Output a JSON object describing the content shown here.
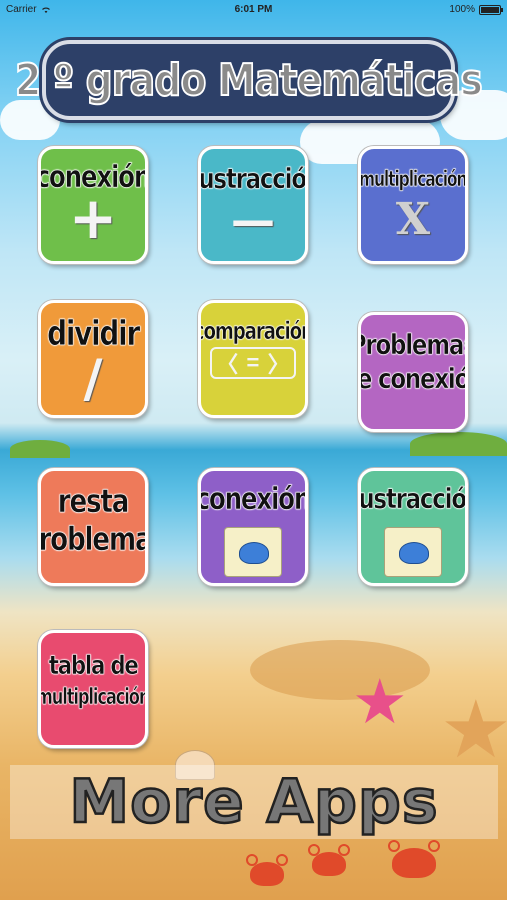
{
  "status_bar": {
    "carrier": "Carrier",
    "time": "6:01 PM",
    "battery": "100%",
    "battery_level": 1.0
  },
  "title": "2 º grado Matemáticas",
  "tiles": [
    {
      "label": "conexión",
      "symbol": "+",
      "color": "#6fbf4a"
    },
    {
      "label": "sustracción",
      "symbol": "—",
      "color": "#4ab8c8"
    },
    {
      "label": "multiplicación",
      "symbol": "X",
      "color": "#5a6fcf"
    },
    {
      "label": "dividir",
      "symbol": "/",
      "color": "#f09a3a"
    },
    {
      "label": "comparación",
      "symbol_left": "〈",
      "symbol_mid": "=",
      "symbol_right": "〉",
      "color": "#d8d23a"
    },
    {
      "label_line1": "Problemas",
      "label_line2": "de conexión",
      "color": "#b466c2"
    },
    {
      "label_line1": "resta",
      "label_line2": "problemas",
      "color": "#ee7a5a"
    },
    {
      "label": "conexión",
      "color": "#8e5fc8"
    },
    {
      "label": "sustracción",
      "color": "#5fc49a"
    },
    {
      "label_line1": "tabla de",
      "label_line2": "multiplicación",
      "color": "#e84b6f"
    }
  ],
  "more_apps": "More Apps",
  "icons": {
    "wifi": "wifi-icon",
    "puzzle": "puzzle-icon",
    "starfish": "starfish-icon",
    "crab": "crab-icon"
  }
}
